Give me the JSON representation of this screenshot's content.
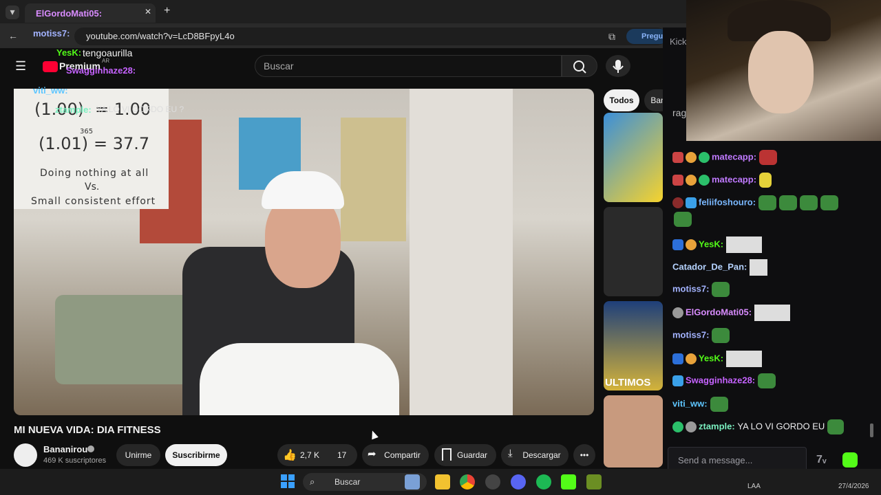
{
  "browser": {
    "tab_title": "ElGordoMati05:",
    "url": "youtube.com/watch?v=LcD8BFpyL4o",
    "new_tab": "+",
    "extension_label": "Pregun"
  },
  "youtube": {
    "premium_label": "Premium",
    "premium_region": "AR",
    "search_placeholder": "Buscar",
    "chips": [
      "Todos",
      "Ban"
    ],
    "video": {
      "title": "MI NUEVA VIDA: DIA FITNESS",
      "formula_line1": "(1.00)",
      "formula_line1_result": "= 1.00",
      "formula_exp": "365",
      "formula_line2": "(1.01)",
      "formula_line2_result": "= 37.7",
      "caption1": "Doing nothing at all",
      "caption2": "Vs.",
      "caption3": "Small consistent effort"
    },
    "channel": {
      "name": "Bananirou",
      "subscribers": "469 K suscriptores",
      "join_label": "Unirme",
      "subscribe_label": "Suscribirme"
    },
    "actions": {
      "likes": "2,7 K",
      "dislikes": "17",
      "share": "Compartir",
      "save": "Guardar",
      "download": "Descargar"
    },
    "rec_thumb_text": "ULTIMOS"
  },
  "chat": {
    "header": "Kick",
    "partial_name": "rag",
    "input_placeholder": "Send a message...",
    "messages": [
      {
        "user": "matecapp:",
        "color": "#c07aff",
        "emote": "mushroom"
      },
      {
        "user": "matecapp:",
        "color": "#c07aff",
        "emote": "banana"
      },
      {
        "user": "feliifoshouro:",
        "color": "#7ab8ff",
        "emote": "pepe"
      },
      {
        "user": "YesK:",
        "color": "#53fc18",
        "emote": "image"
      },
      {
        "user": "Catador_De_Pan:",
        "color": "#b6d3ff",
        "emote": "image"
      },
      {
        "user": "motiss7:",
        "color": "#a3b3ff",
        "emote": "pepe"
      },
      {
        "user": "ElGordoMati05:",
        "color": "#d98cff",
        "emote": "image"
      },
      {
        "user": "motiss7:",
        "color": "#a3b3ff",
        "emote": "pepe"
      },
      {
        "user": "YesK:",
        "color": "#53fc18",
        "emote": "image"
      },
      {
        "user": "Swagginhaze28:",
        "color": "#c663ff",
        "emote": "pepe"
      },
      {
        "user": "viti_ww:",
        "color": "#5ec6ff",
        "emote": "pepe"
      },
      {
        "user": "ztample:",
        "color": "#7af0c0",
        "text": "YA LO VI GORDO EU"
      }
    ]
  },
  "overlay": {
    "lines": [
      {
        "user": "ElGordoMati05:",
        "text": ""
      },
      {
        "user": "motiss7:",
        "text": ""
      },
      {
        "user": "YesK:",
        "text": "tengoaurilla"
      },
      {
        "user": "Swagginhaze28:",
        "text": ""
      },
      {
        "user": "viti_ww:",
        "text": ""
      },
      {
        "user": "ztample:",
        "text": "YA LO VI GORDO EU ?"
      }
    ]
  },
  "taskbar": {
    "search": "Buscar",
    "lang": "LAA",
    "date": "27/4/2026"
  },
  "colors": {
    "kick_green": "#53fc18",
    "youtube_red": "#ff0033"
  }
}
